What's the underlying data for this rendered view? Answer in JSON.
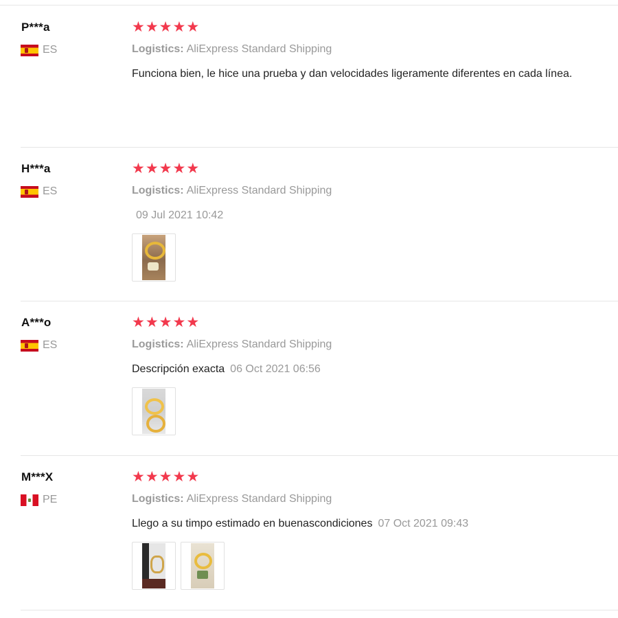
{
  "logistics_label": "Logistics:",
  "reviews": [
    {
      "user": "P***a",
      "country": "ES",
      "stars": 5,
      "logistics": "AliExpress Standard Shipping",
      "text": "Funciona bien, le hice una prueba y dan velocidades ligeramente diferentes en cada línea.",
      "date": ""
    },
    {
      "user": "H***a",
      "country": "ES",
      "stars": 5,
      "logistics": "AliExpress Standard Shipping",
      "text": "",
      "date": "09 Jul 2021 10:42"
    },
    {
      "user": "A***o",
      "country": "ES",
      "stars": 5,
      "logistics": "AliExpress Standard Shipping",
      "text": "Descripción exacta",
      "date": "06 Oct 2021 06:56"
    },
    {
      "user": "M***X",
      "country": "PE",
      "stars": 5,
      "logistics": "AliExpress Standard Shipping",
      "text": "Llego a su timpo estimado en buenascondiciones",
      "date": "07 Oct 2021 09:43"
    }
  ],
  "colors": {
    "star": "#f2394d",
    "muted_text": "#999999",
    "divider": "#e6e6e6"
  }
}
